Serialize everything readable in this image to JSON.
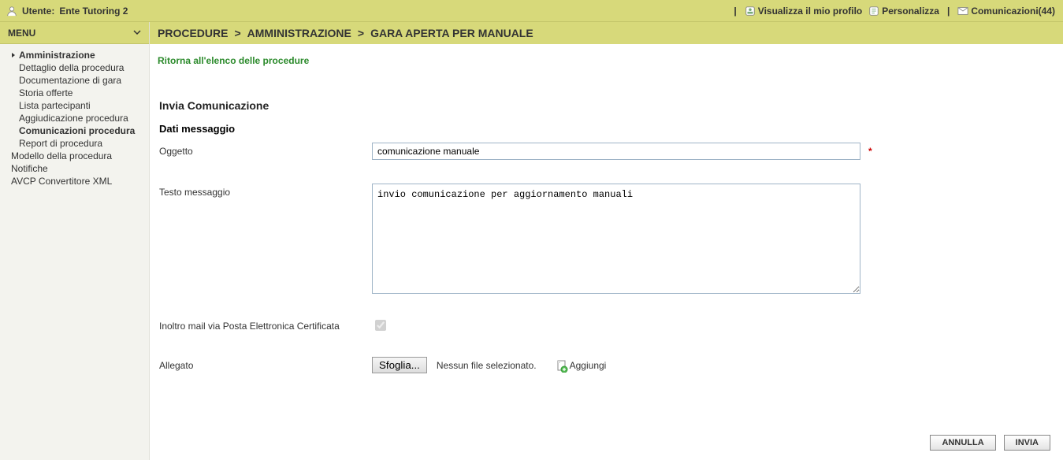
{
  "topbar": {
    "user_prefix": "Utente:",
    "user_name": "Ente Tutoring 2",
    "profile": "Visualizza il mio profilo",
    "personalize": "Personalizza",
    "comms": "Comunicazioni(44)"
  },
  "menu": {
    "title": "MENU",
    "items": [
      {
        "label": "Amministrazione",
        "level": 1,
        "bold": true,
        "arrow": true
      },
      {
        "label": "Dettaglio della procedura",
        "level": 2
      },
      {
        "label": "Documentazione di gara",
        "level": 2
      },
      {
        "label": "Storia offerte",
        "level": 2
      },
      {
        "label": "Lista partecipanti",
        "level": 2
      },
      {
        "label": "Aggiudicazione procedura",
        "level": 2
      },
      {
        "label": "Comunicazioni procedura",
        "level": 2,
        "bold": true
      },
      {
        "label": "Report di procedura",
        "level": 2
      },
      {
        "label": "Modello della procedura",
        "level": 1
      },
      {
        "label": "Notifiche",
        "level": 1
      },
      {
        "label": "AVCP Convertitore XML",
        "level": 1
      }
    ]
  },
  "breadcrumb": {
    "a": "PROCEDURE",
    "b": "AMMINISTRAZIONE",
    "c": "GARA APERTA PER MANUALE"
  },
  "backlink": "Ritorna all'elenco delle procedure",
  "form": {
    "title": "Invia Comunicazione",
    "sub": "Dati messaggio",
    "oggetto_label": "Oggetto",
    "oggetto_value": "comunicazione manuale",
    "testo_label": "Testo messaggio",
    "testo_value": "invio comunicazione per aggiornamento manuali",
    "pec_label": "Inoltro mail via Posta Elettronica Certificata",
    "allegato_label": "Allegato",
    "browse": "Sfoglia...",
    "nofile": "Nessun file selezionato.",
    "add": "Aggiungi",
    "cancel": "ANNULLA",
    "send": "INVIA"
  }
}
